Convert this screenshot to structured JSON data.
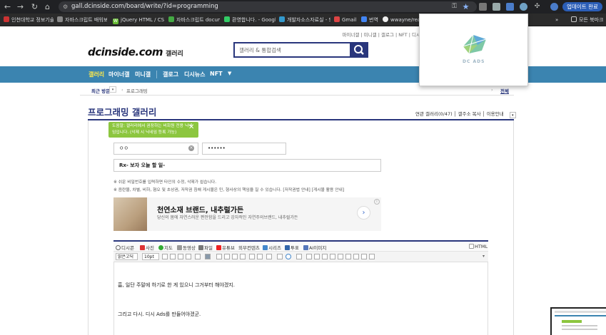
{
  "browser": {
    "url": "gall.dcinside.com/board/write/?id=programming",
    "update_label": "업데이트 완료",
    "bookmarks": [
      {
        "label": "인천대학교 정보기술..."
      },
      {
        "label": "자바스크립트 배워보..."
      },
      {
        "label": "jQuery HTML / CS..."
      },
      {
        "label": "자바스크립트 docum..."
      },
      {
        "label": "환영합니다. - Googl..."
      },
      {
        "label": "개발자소스자료실 - S..."
      },
      {
        "label": "Gmail"
      },
      {
        "label": "번역"
      },
      {
        "label": "wwayne/react..."
      }
    ],
    "bookmarks_more": "»",
    "all_bookmarks": "모든 북마크"
  },
  "header": {
    "top_links": "마이너갤 | 미니갤 | 갤로그 | NFT | 디시",
    "logo": "dcinside.com",
    "logo_suffix": "갤러리",
    "search_placeholder": "갤러리 & 통합검색"
  },
  "nav": {
    "items": [
      "갤러리",
      "마이너갤",
      "미니갤",
      "갤로그",
      "디시뉴스",
      "NFT"
    ]
  },
  "crumb": {
    "recent": "최근 방문",
    "current": "프로그래밍",
    "all": "전체"
  },
  "gallery": {
    "title": "프로그래밍 갤러리",
    "tools": "연관 갤러리(0/47) │ 갤주소 복사 │ 이용안내"
  },
  "form": {
    "tip": "도움말: 갤러리에서 권장하는 비회원 전용 닉네임입니다. (삭제 시 닉네임 등록 가능)",
    "nickname": "ㅇㅇ",
    "password": "••••••",
    "subject": "Rx- 보자 오늘 할 일-",
    "notice1": "※ 쉬운 비밀번호를 입력하면 타인의 수정, 삭제가 쉽습니다.",
    "notice2": "※ 음란물, 차별, 비하, 혐오 및 초상권, 저작권 침해 게시물은 민, 형사상의 책임을 질 수 있습니다. [저작권법 안내] [게시물 활용 안내]"
  },
  "ad": {
    "title": "천연소재 브랜드, 내추럴가든",
    "subtitle": "당신의 몸에 자연스러운 편안함을 드리고 강자적인 자연주의브랜드, 내추럴가든",
    "info": "i"
  },
  "toolbar1": {
    "items": [
      "디시콘",
      "사진",
      "지도",
      "동영상",
      "파일",
      "유튜브",
      "외부컨텐츠",
      "시리즈",
      "투표",
      "AI이미지"
    ],
    "html_label": "HTML"
  },
  "toolbar2": {
    "font": "맑은고딕",
    "size": "10pt"
  },
  "editor": {
    "line1": "흠, 일단 주말에 하기로 한 게 있으니 그거부터 해야겠지.",
    "line2": "그리고 다시. 디시 Ads를 만들어야겠군."
  },
  "popup": {
    "label": "DC ADS"
  },
  "colors": {
    "brand_navy": "#29367c",
    "nav_blue": "#3b84b0",
    "tip_green": "#8cc63f"
  }
}
